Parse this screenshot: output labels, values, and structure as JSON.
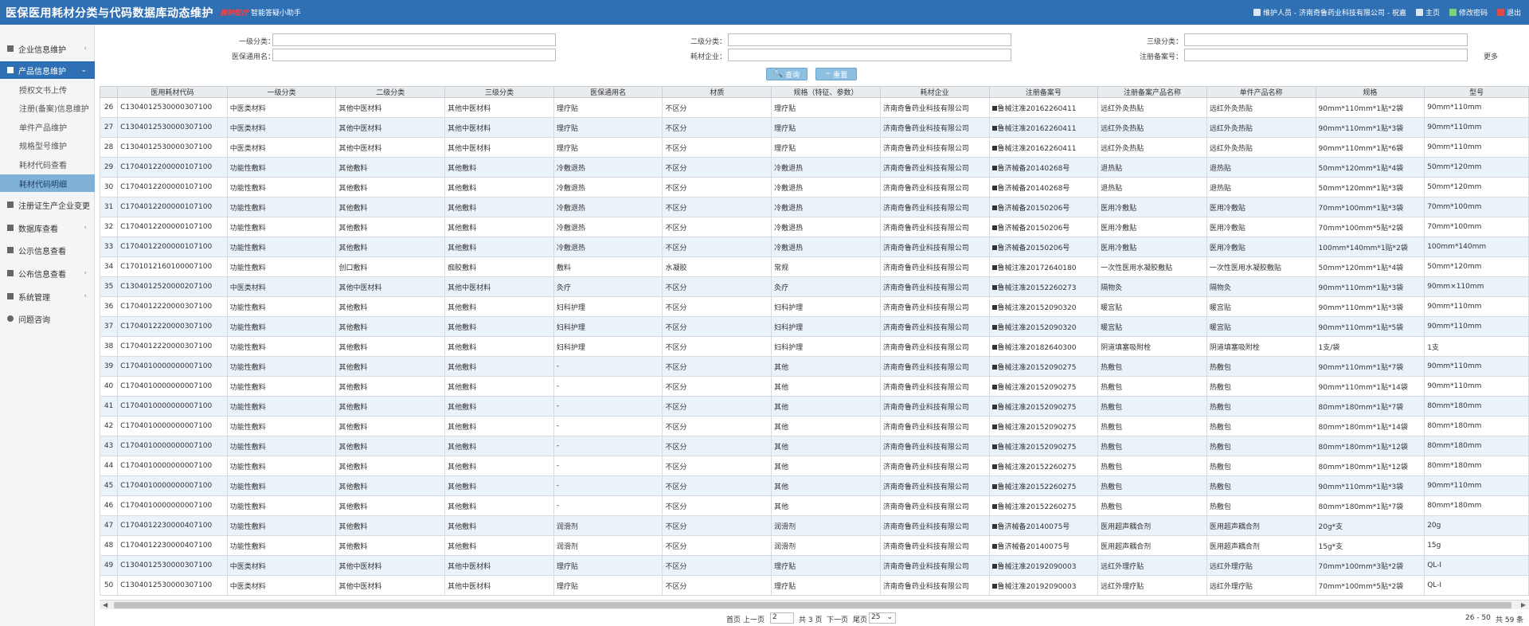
{
  "header": {
    "title": "医保医用耗材分类与代码数据库动态维护",
    "logo_badge": "晨钟医疗",
    "assistant": "智能答疑小助手",
    "user": "维护人员 - 济南奇鲁药业科技有限公司 - 祝嘉",
    "home": "主页",
    "change_password": "修改密码",
    "logout": "退出",
    "colors": {
      "bar": "#2f6fb3",
      "badge": "#ff3b3b"
    }
  },
  "sidebar": {
    "items": [
      {
        "label": "企业信息维护",
        "icon": "building-icon",
        "chevron": "‹"
      },
      {
        "label": "产品信息维护",
        "icon": "box-icon",
        "chevron": "⌄",
        "active": true
      },
      {
        "label": "注册证生产企业变更",
        "icon": "doc-icon"
      },
      {
        "label": "数据库查看",
        "icon": "db-icon",
        "chevron": "‹"
      },
      {
        "label": "公示信息查看",
        "icon": "list-icon"
      },
      {
        "label": "公布信息查看",
        "icon": "list-icon",
        "chevron": "‹"
      },
      {
        "label": "系统管理",
        "icon": "gear-icon",
        "chevron": "‹"
      },
      {
        "label": "问题咨询",
        "icon": "question-icon"
      }
    ],
    "subitems": [
      "授权文书上传",
      "注册(备案)信息维护",
      "单件产品维护",
      "规格型号维护",
      "耗材代码查看",
      "耗材代码明细"
    ],
    "active_sub": "耗材代码明细"
  },
  "search": {
    "level1_label": "一级分类：",
    "level2_label": "二级分类：",
    "level3_label": "三级分类：",
    "generic_label": "医保通用名：",
    "company_label": "耗材企业：",
    "regno_label": "注册备案号：",
    "more": "更多",
    "query_btn": "查询",
    "reset_btn": "重置"
  },
  "table": {
    "columns": [
      "",
      "医用耗材代码",
      "一级分类",
      "二级分类",
      "三级分类",
      "医保通用名",
      "材质",
      "规格（特征、参数）",
      "耗材企业",
      "注册备案号",
      "注册备案产品名称",
      "单件产品名称",
      "规格",
      "型号"
    ],
    "rows": [
      [
        "26",
        "C130401253000030710​0",
        "中医类材料",
        "其他中医材料",
        "其他中医材料",
        "理疗贴",
        "不区分",
        "理疗贴",
        "济南奇鲁药业科技有限公司",
        "鲁械注准20162260411",
        "远红外灸热贴",
        "远红外灸热贴",
        "90mm*110mm*1贴*2袋",
        "90mm*110mm"
      ],
      [
        "27",
        "C130401253000030710​0",
        "中医类材料",
        "其他中医材料",
        "其他中医材料",
        "理疗贴",
        "不区分",
        "理疗贴",
        "济南奇鲁药业科技有限公司",
        "鲁械注准20162260411",
        "远红外灸热贴",
        "远红外灸热贴",
        "90mm*110mm*1贴*3袋",
        "90mm*110mm"
      ],
      [
        "28",
        "C130401253000030710​0",
        "中医类材料",
        "其他中医材料",
        "其他中医材料",
        "理疗贴",
        "不区分",
        "理疗贴",
        "济南奇鲁药业科技有限公司",
        "鲁械注准20162260411",
        "远红外灸热贴",
        "远红外灸热贴",
        "90mm*110mm*1贴*6袋",
        "90mm*110mm"
      ],
      [
        "29",
        "C170401220000010710​0",
        "功能性敷料",
        "其他敷料",
        "其他敷料",
        "冷敷退热",
        "不区分",
        "冷敷退热",
        "济南奇鲁药业科技有限公司",
        "鲁济械备20140268号",
        "退热贴",
        "退热贴",
        "50mm*120mm*1贴*4袋",
        "50mm*120mm"
      ],
      [
        "30",
        "C170401220000010710​0",
        "功能性敷料",
        "其他敷料",
        "其他敷料",
        "冷敷退热",
        "不区分",
        "冷敷退热",
        "济南奇鲁药业科技有限公司",
        "鲁济械备20140268号",
        "退热贴",
        "退热贴",
        "50mm*120mm*1贴*3袋",
        "50mm*120mm"
      ],
      [
        "31",
        "C170401220000010710​0",
        "功能性敷料",
        "其他敷料",
        "其他敷料",
        "冷敷退热",
        "不区分",
        "冷敷退热",
        "济南奇鲁药业科技有限公司",
        "鲁济械备20150206号",
        "医用冷敷贴",
        "医用冷敷贴",
        "70mm*100mm*1贴*3袋",
        "70mm*100mm"
      ],
      [
        "32",
        "C170401220000010710​0",
        "功能性敷料",
        "其他敷料",
        "其他敷料",
        "冷敷退热",
        "不区分",
        "冷敷退热",
        "济南奇鲁药业科技有限公司",
        "鲁济械备20150206号",
        "医用冷敷贴",
        "医用冷敷贴",
        "70mm*100mm*5贴*2袋",
        "70mm*100mm"
      ],
      [
        "33",
        "C170401220000010710​0",
        "功能性敷料",
        "其他敷料",
        "其他敷料",
        "冷敷退热",
        "不区分",
        "冷敷退热",
        "济南奇鲁药业科技有限公司",
        "鲁济械备20150206号",
        "医用冷敷贴",
        "医用冷敷贴",
        "100mm*140mm*1贴*2袋",
        "100mm*140mm"
      ],
      [
        "34",
        "C170101216010000710​0",
        "功能性敷料",
        "创口敷料",
        "痂胶敷料",
        "敷料",
        "水凝胶",
        "常规",
        "济南奇鲁药业科技有限公司",
        "鲁械注准20172640180",
        "一次性医用水凝胶敷贴",
        "一次性医用水凝胶敷贴",
        "50mm*120mm*1贴*4袋",
        "50mm*120mm"
      ],
      [
        "35",
        "C130401252000020710​0",
        "中医类材料",
        "其他中医材料",
        "其他中医材料",
        "灸疗",
        "不区分",
        "灸疗",
        "济南奇鲁药业科技有限公司",
        "鲁械注准20152260273",
        "隔物灸",
        "隔物灸",
        "90mm*110mm*1贴*3袋",
        "90mm×110mm"
      ],
      [
        "36",
        "C170401222000030710​0",
        "功能性敷料",
        "其他敷料",
        "其他敷料",
        "妇科护理",
        "不区分",
        "妇科护理",
        "济南奇鲁药业科技有限公司",
        "鲁械注准20152090320",
        "暖宫贴",
        "暖宫贴",
        "90mm*110mm*1贴*3袋",
        "90mm*110mm"
      ],
      [
        "37",
        "C170401222000030710​0",
        "功能性敷料",
        "其他敷料",
        "其他敷料",
        "妇科护理",
        "不区分",
        "妇科护理",
        "济南奇鲁药业科技有限公司",
        "鲁械注准20152090320",
        "暖宫贴",
        "暖宫贴",
        "90mm*110mm*1贴*5袋",
        "90mm*110mm"
      ],
      [
        "38",
        "C170401222000030710​0",
        "功能性敷料",
        "其他敷料",
        "其他敷料",
        "妇科护理",
        "不区分",
        "妇科护理",
        "济南奇鲁药业科技有限公司",
        "鲁械注准20182640300",
        "阴道填塞吸附栓",
        "阴道填塞吸附栓",
        "1支/袋",
        "1支"
      ],
      [
        "39",
        "C170401000000000710​0",
        "功能性敷料",
        "其他敷料",
        "其他敷料",
        "-",
        "不区分",
        "其他",
        "济南奇鲁药业科技有限公司",
        "鲁械注准20152090275",
        "热敷包",
        "热敷包",
        "90mm*110mm*1贴*7袋",
        "90mm*110mm"
      ],
      [
        "40",
        "C170401000000000710​0",
        "功能性敷料",
        "其他敷料",
        "其他敷料",
        "-",
        "不区分",
        "其他",
        "济南奇鲁药业科技有限公司",
        "鲁械注准20152090275",
        "热敷包",
        "热敷包",
        "90mm*110mm*1贴*14袋",
        "90mm*110mm"
      ],
      [
        "41",
        "C170401000000000710​0",
        "功能性敷料",
        "其他敷料",
        "其他敷料",
        "-",
        "不区分",
        "其他",
        "济南奇鲁药业科技有限公司",
        "鲁械注准20152090275",
        "热敷包",
        "热敷包",
        "80mm*180mm*1贴*7袋",
        "80mm*180mm"
      ],
      [
        "42",
        "C170401000000000710​0",
        "功能性敷料",
        "其他敷料",
        "其他敷料",
        "-",
        "不区分",
        "其他",
        "济南奇鲁药业科技有限公司",
        "鲁械注准20152090275",
        "热敷包",
        "热敷包",
        "80mm*180mm*1贴*14袋",
        "80mm*180mm"
      ],
      [
        "43",
        "C170401000000000710​0",
        "功能性敷料",
        "其他敷料",
        "其他敷料",
        "-",
        "不区分",
        "其他",
        "济南奇鲁药业科技有限公司",
        "鲁械注准20152090275",
        "热敷包",
        "热敷包",
        "80mm*180mm*1贴*12袋",
        "80mm*180mm"
      ],
      [
        "44",
        "C170401000000000710​0",
        "功能性敷料",
        "其他敷料",
        "其他敷料",
        "-",
        "不区分",
        "其他",
        "济南奇鲁药业科技有限公司",
        "鲁械注准20152260275",
        "热敷包",
        "热敷包",
        "80mm*180mm*1贴*12袋",
        "80mm*180mm"
      ],
      [
        "45",
        "C170401000000000710​0",
        "功能性敷料",
        "其他敷料",
        "其他敷料",
        "-",
        "不区分",
        "其他",
        "济南奇鲁药业科技有限公司",
        "鲁械注准20152260275",
        "热敷包",
        "热敷包",
        "90mm*110mm*1贴*3袋",
        "90mm*110mm"
      ],
      [
        "46",
        "C170401000000000710​0",
        "功能性敷料",
        "其他敷料",
        "其他敷料",
        "-",
        "不区分",
        "其他",
        "济南奇鲁药业科技有限公司",
        "鲁械注准20152260275",
        "热敷包",
        "热敷包",
        "80mm*180mm*1贴*7袋",
        "80mm*180mm"
      ],
      [
        "47",
        "C170401223000040710​0",
        "功能性敷料",
        "其他敷料",
        "其他敷料",
        "润滑剂",
        "不区分",
        "润滑剂",
        "济南奇鲁药业科技有限公司",
        "鲁济械备20140075号",
        "医用超声耦合剂",
        "医用超声耦合剂",
        "20g*支",
        "20g"
      ],
      [
        "48",
        "C170401223000040710​0",
        "功能性敷料",
        "其他敷料",
        "其他敷料",
        "润滑剂",
        "不区分",
        "润滑剂",
        "济南奇鲁药业科技有限公司",
        "鲁济械备20140075号",
        "医用超声耦合剂",
        "医用超声耦合剂",
        "15g*支",
        "15g"
      ],
      [
        "49",
        "C130401253000030710​0",
        "中医类材料",
        "其他中医材料",
        "其他中医材料",
        "理疗贴",
        "不区分",
        "理疗贴",
        "济南奇鲁药业科技有限公司",
        "鲁械注准20192090003",
        "远红外理疗贴",
        "远红外理疗贴",
        "70mm*100mm*3贴*2袋",
        "QL-I"
      ],
      [
        "50",
        "C130401253000030710​0",
        "中医类材料",
        "其他中医材料",
        "其他中医材料",
        "理疗贴",
        "不区分",
        "理疗贴",
        "济南奇鲁药业科技有限公司",
        "鲁械注准20192090003",
        "远红外理疗贴",
        "远红外理疗贴",
        "70mm*100mm*5贴*2袋",
        "QL-I"
      ]
    ]
  },
  "pager": {
    "first": "首页",
    "prev": "上一页",
    "page_value": "2",
    "total_pages": "共 3 页",
    "next": "下一页",
    "last": "尾页",
    "page_size": "25",
    "range": "26 - 50",
    "total": "共 59 条"
  }
}
